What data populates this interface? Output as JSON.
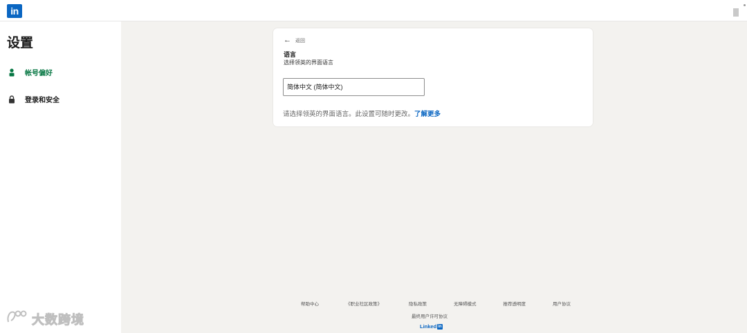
{
  "header": {
    "logo_text": "in",
    "brand_color": "#0a66c2"
  },
  "sidebar": {
    "title": "设置",
    "items": [
      {
        "label": "帐号偏好",
        "icon": "person-icon",
        "active": true,
        "color": "#057642"
      },
      {
        "label": "登录和安全",
        "icon": "lock-icon",
        "active": false
      }
    ]
  },
  "card": {
    "back_label": "返回",
    "section_title": "语言",
    "section_subtitle": "选择领英的界面语言",
    "select_value": "简体中文 (简体中文)",
    "note_text": "请选择领英的界面语言。此设置可随时更改。",
    "learn_more": "了解更多"
  },
  "footer": {
    "links": [
      "帮助中心",
      "《职业社区政策》",
      "隐私政策",
      "无障碍模式",
      "推荐透明度",
      "用户协议"
    ],
    "agreement": "最终用户许可协议",
    "brand_text": "Linked",
    "brand_box": "in"
  },
  "watermark": {
    "text": "大数跨境"
  }
}
